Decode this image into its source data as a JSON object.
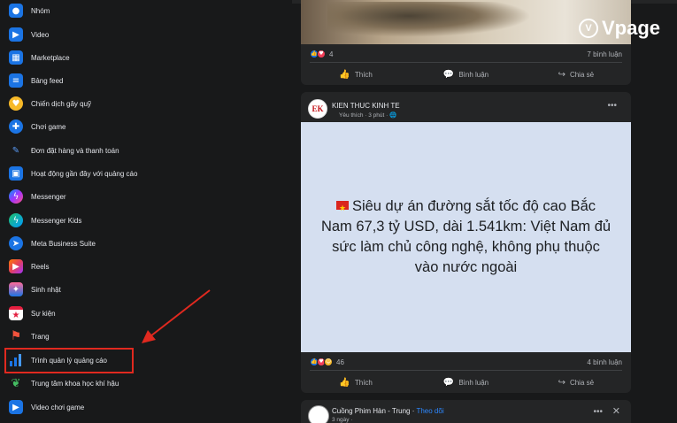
{
  "sidebar": {
    "items": [
      {
        "label": "Nhóm",
        "icon": "groups-icon",
        "color": "#1b74e4"
      },
      {
        "label": "Video",
        "icon": "video-icon",
        "color": "#1b74e4"
      },
      {
        "label": "Marketplace",
        "icon": "marketplace-icon",
        "color": "#1b74e4"
      },
      {
        "label": "Bảng feed",
        "icon": "feeds-icon",
        "color": "#1b74e4"
      },
      {
        "label": "Chiến dịch gây quỹ",
        "icon": "fundraiser-icon",
        "color": "#f7b928"
      },
      {
        "label": "Chơi game",
        "icon": "gaming-icon",
        "color": "#1b74e4"
      },
      {
        "label": "Đơn đặt hàng và thanh toán",
        "icon": "orders-payments-icon",
        "color": "#1b74e4"
      },
      {
        "label": "Hoạt động gần đây với quảng cáo",
        "icon": "ad-activity-icon",
        "color": "#1b74e4"
      },
      {
        "label": "Messenger",
        "icon": "messenger-icon",
        "color": "#a033ff"
      },
      {
        "label": "Messenger Kids",
        "icon": "messenger-kids-icon",
        "color": "#1fc26b"
      },
      {
        "label": "Meta Business Suite",
        "icon": "business-suite-icon",
        "color": "#1b74e4"
      },
      {
        "label": "Reels",
        "icon": "reels-icon",
        "color": "#e4405f"
      },
      {
        "label": "Sinh nhật",
        "icon": "birthday-icon",
        "color": "#1b74e4"
      },
      {
        "label": "Sự kiện",
        "icon": "events-icon",
        "color": "#e41e3f"
      },
      {
        "label": "Trang",
        "icon": "pages-icon",
        "color": "#f5533d"
      },
      {
        "label": "Trình quản lý quảng cáo",
        "icon": "ads-manager-icon",
        "color": "#1b74e4"
      },
      {
        "label": "Trung tâm khoa học khí hậu",
        "icon": "climate-center-icon",
        "color": "#45bd62"
      },
      {
        "label": "Video chơi game",
        "icon": "gaming-video-icon",
        "color": "#1b74e4"
      }
    ]
  },
  "watermark": {
    "text": "Vpage",
    "icon": "vpage-logo-icon"
  },
  "feed": {
    "post1": {
      "reaction_count": "4",
      "comments": "7 bình luận",
      "actions": {
        "like": "Thích",
        "comment": "Bình luận",
        "share": "Chia sẻ"
      }
    },
    "post2": {
      "avatar_text": "EK",
      "author": "KIEN THUC KINH TE",
      "meta": "Yêu thích · 3 phút ·",
      "image_text": "Siêu dự án đường sắt tốc độ cao Bắc Nam 67,3 tỷ USD, dài 1.541km: Việt Nam đủ sức làm chủ công nghệ, không phụ thuộc vào nước ngoài",
      "reaction_count": "46",
      "comments": "4 bình luận",
      "actions": {
        "like": "Thích",
        "comment": "Bình luận",
        "share": "Chia sẻ"
      }
    },
    "post3": {
      "author": "Cuồng Phim Hàn - Trung",
      "follow": "Theo dõi",
      "meta": "3 ngày ·"
    }
  },
  "colors": {
    "highlight": "#e0291f",
    "background": "#18191a",
    "card": "#242526",
    "link": "#2d88ff"
  }
}
